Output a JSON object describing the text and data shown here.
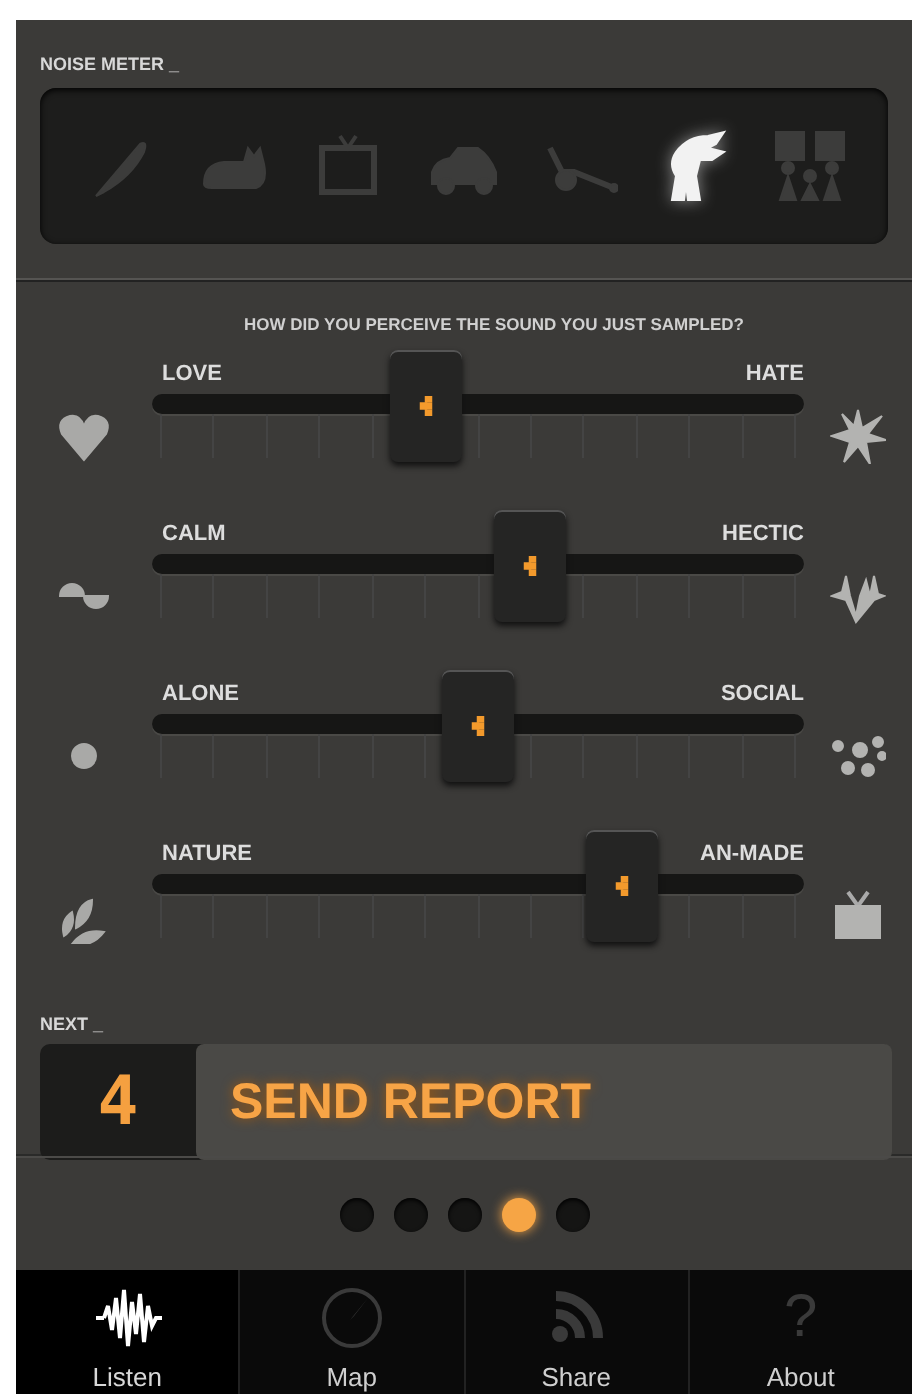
{
  "noise_meter": {
    "label": "NOISE METER _",
    "levels": [
      {
        "kind": "feather",
        "selected": false
      },
      {
        "kind": "cat",
        "selected": false
      },
      {
        "kind": "tv",
        "selected": false
      },
      {
        "kind": "car",
        "selected": false
      },
      {
        "kind": "mower",
        "selected": false
      },
      {
        "kind": "dinosaur",
        "selected": true
      },
      {
        "kind": "crowd",
        "selected": false
      }
    ]
  },
  "question": "HOW DID YOU PERCEIVE THE SOUND YOU JUST SAMPLED?",
  "sliders": [
    {
      "left": "LOVE",
      "right": "HATE",
      "left_icon": {
        "kind": "heart"
      },
      "right_icon": {
        "kind": "burst"
      },
      "level": 0.42
    },
    {
      "left": "CALM",
      "right": "HECTIC",
      "left_icon": {
        "kind": "wave"
      },
      "right_icon": {
        "kind": "spikes"
      },
      "level": 0.58
    },
    {
      "left": "ALONE",
      "right": "SOCIAL",
      "left_icon": {
        "kind": "dot"
      },
      "right_icon": {
        "kind": "dots"
      },
      "level": 0.5
    },
    {
      "left": "NATURE",
      "right": "AN-MADE",
      "left_icon": {
        "kind": "leaves"
      },
      "right_icon": {
        "kind": "tv"
      },
      "level": 0.72
    }
  ],
  "next": {
    "label": "NEXT _",
    "step": "4",
    "button": "SEND REPORT"
  },
  "pages": [
    {
      "selected": false
    },
    {
      "selected": false
    },
    {
      "selected": false
    },
    {
      "selected": true
    },
    {
      "selected": false
    }
  ],
  "tabs": [
    {
      "kind": "listen",
      "label": "Listen",
      "selected": true
    },
    {
      "kind": "map",
      "label": "Map",
      "selected": false
    },
    {
      "kind": "share",
      "label": "Share",
      "selected": false
    },
    {
      "kind": "about",
      "label": "About",
      "glyph": "?",
      "selected": false
    }
  ]
}
